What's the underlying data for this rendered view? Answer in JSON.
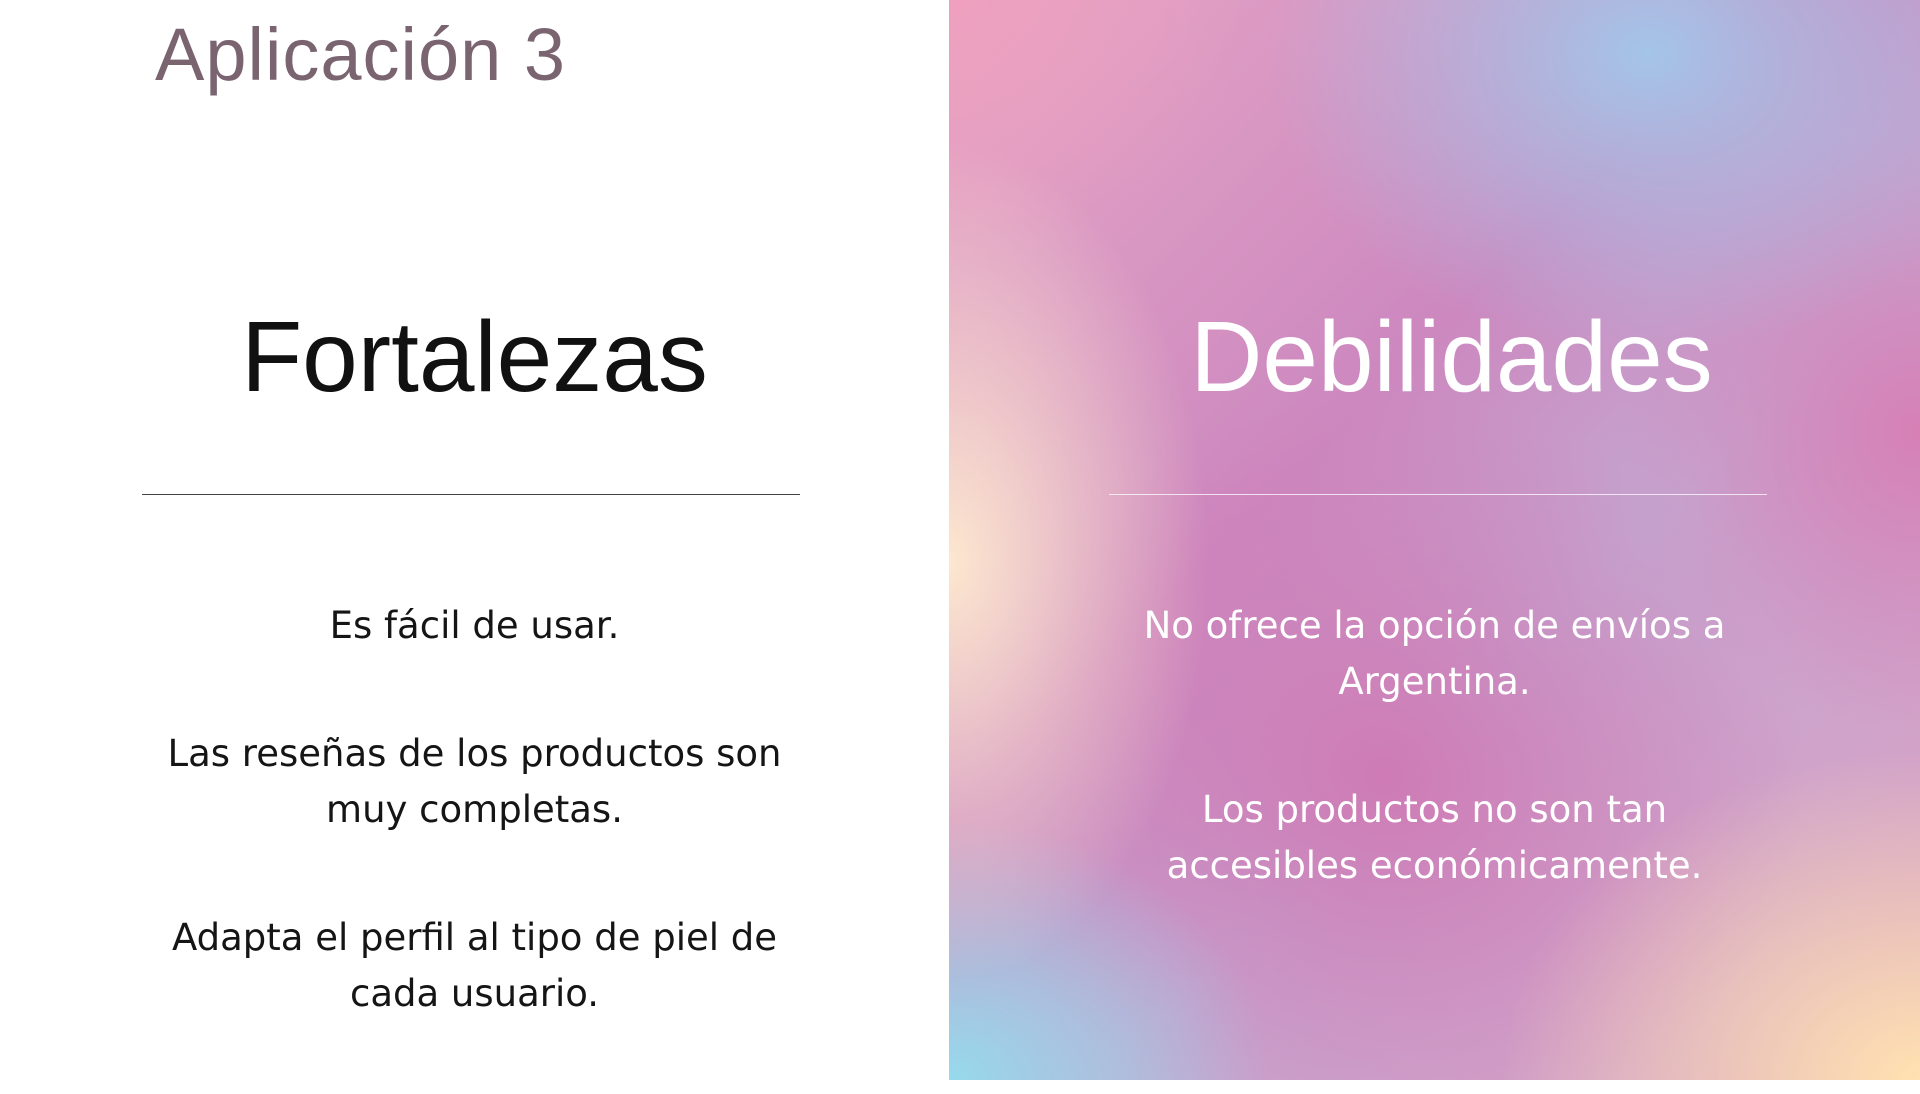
{
  "title": "Aplicación 3",
  "strengths": {
    "heading": "Fortalezas",
    "items": [
      "Es fácil de usar.",
      "Las reseñas de los productos son muy completas.",
      "Adapta el perfil al tipo de piel de cada usuario."
    ]
  },
  "weaknesses": {
    "heading": "Debilidades",
    "items": [
      "No ofrece la opción de envíos a Argentina.",
      "Los productos no son tan accesibles económicamente."
    ]
  },
  "colors": {
    "title": "#7a6470",
    "panel_accent": "#cc88bf"
  }
}
